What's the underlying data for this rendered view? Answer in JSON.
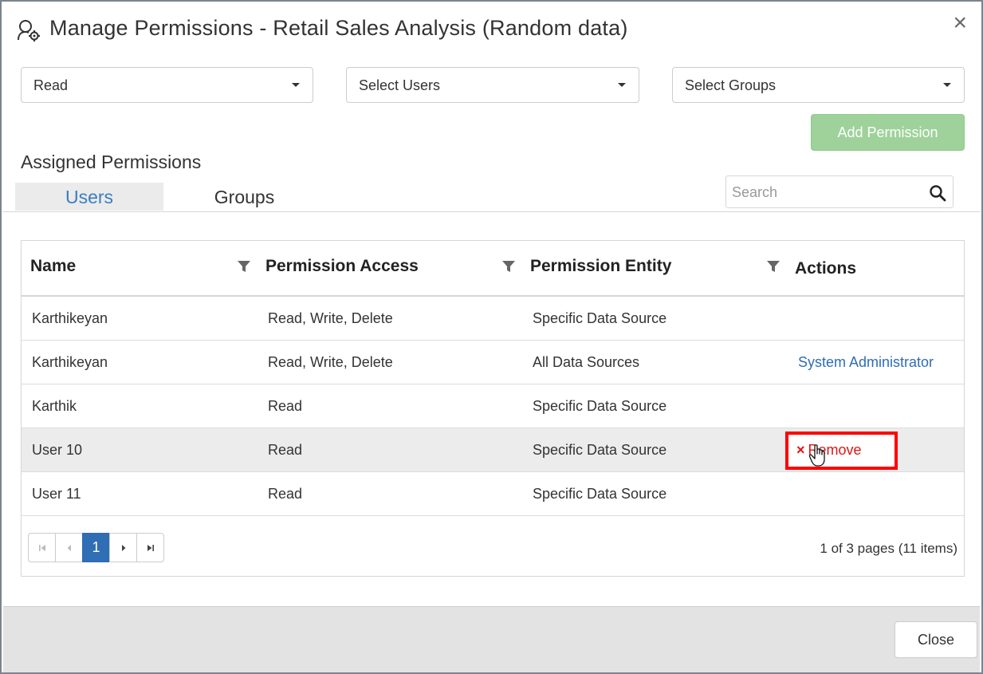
{
  "dialog": {
    "title": "Manage Permissions - Retail Sales Analysis (Random data)",
    "title_icon": "user-settings-icon",
    "close_icon": "×"
  },
  "controls": {
    "access_dropdown": "Read",
    "users_dropdown": "Select Users",
    "groups_dropdown": "Select Groups",
    "add_permission": "Add Permission"
  },
  "assigned": {
    "title": "Assigned Permissions",
    "tabs": [
      {
        "label": "Users",
        "active": true
      },
      {
        "label": "Groups",
        "active": false
      }
    ],
    "search_placeholder": "Search"
  },
  "grid": {
    "columns": [
      "Name",
      "Permission Access",
      "Permission Entity",
      "Actions"
    ],
    "rows": [
      {
        "name": "Karthikeyan",
        "access": "Read, Write, Delete",
        "entity": "Specific Data Source",
        "action": ""
      },
      {
        "name": "Karthikeyan",
        "access": "Read, Write, Delete",
        "entity": "All Data Sources",
        "action": "System Administrator"
      },
      {
        "name": "Karthik",
        "access": "Read",
        "entity": "Specific Data Source",
        "action": ""
      },
      {
        "name": "User 10",
        "access": "Read",
        "entity": "Specific Data Source",
        "action": "Remove"
      },
      {
        "name": "User 11",
        "access": "Read",
        "entity": "Specific Data Source",
        "action": ""
      }
    ],
    "remove_icon": "×"
  },
  "pager": {
    "current_page": "1",
    "info": "1 of 3 pages (11 items)"
  },
  "footer": {
    "close": "Close"
  },
  "colors": {
    "accent": "#2f6db5",
    "add_button": "#9ed29a",
    "remove": "#e01414",
    "highlight": "#ff0000"
  }
}
